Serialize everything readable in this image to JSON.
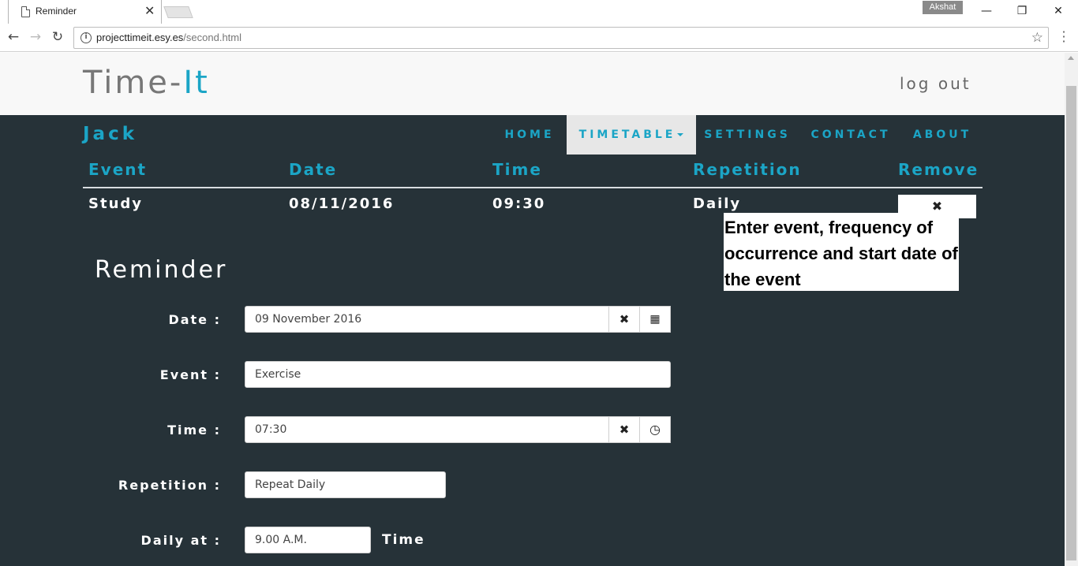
{
  "browser": {
    "tab_title": "Reminder",
    "profile_name": "Akshat",
    "url_host": "projecttimeit.esy.es",
    "url_path": "/second.html"
  },
  "header": {
    "logo_prefix": "Time-",
    "logo_suffix": "It",
    "logout_label": "log out"
  },
  "nav": {
    "username": "Jack",
    "items": [
      "HOME",
      "TIMETABLE",
      "SETTINGS",
      "CONTACT",
      "ABOUT"
    ],
    "active_index": 1
  },
  "table": {
    "headers": [
      "Event",
      "Date",
      "Time",
      "Repetition",
      "Remove"
    ],
    "rows": [
      {
        "event": "Study",
        "date": "08/11/2016",
        "time": "09:30",
        "repetition": "Daily",
        "remove": "✖"
      }
    ]
  },
  "form": {
    "title": "Reminder",
    "date_label": "Date :",
    "date_value": "09 November 2016",
    "event_label": "Event :",
    "event_value": "Exercise",
    "time_label": "Time :",
    "time_value": "07:30",
    "repetition_label": "Repetition :",
    "repetition_value": "Repeat Daily",
    "daily_label": "Daily at :",
    "daily_value": "9.00 A.M.",
    "daily_suffix": "Time"
  },
  "callout": {
    "text": "Enter event, frequency of occurrence and start date of the event"
  },
  "colors": {
    "accent": "#1ba5c6",
    "main_bg": "#263238",
    "header_bg": "#f8f8f8"
  }
}
